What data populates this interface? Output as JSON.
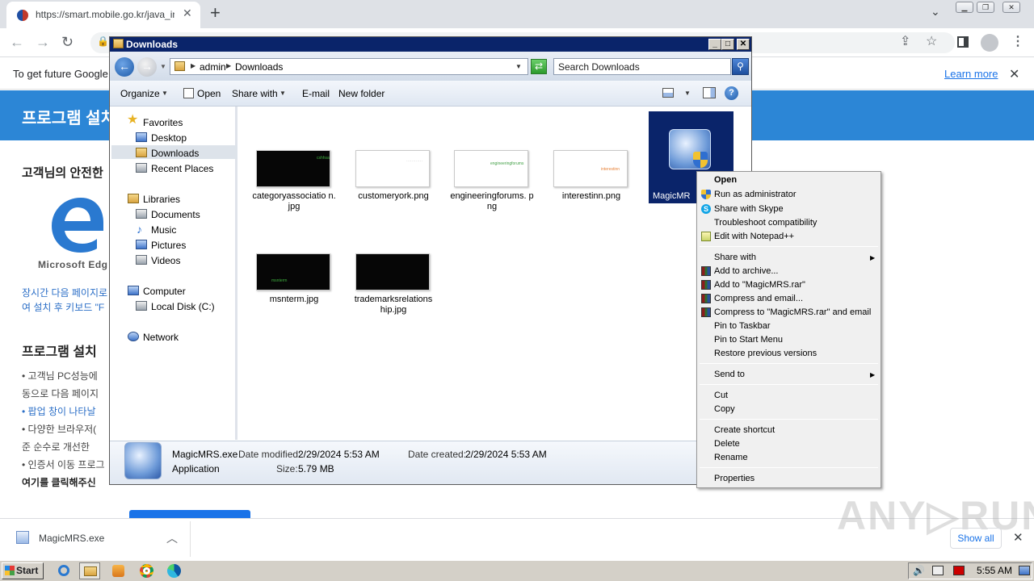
{
  "browser": {
    "tab_title": "https://smart.mobile.go.kr/java_inst",
    "tab_close": "✕",
    "new_tab": "+",
    "infobar_text": "To get future Google",
    "learn_more": "Learn more"
  },
  "page": {
    "banner_title": "프로그램 설치",
    "safety_heading": "고객님의 안전한",
    "edge_label": "Microsoft Edg",
    "blue_text_1": "장시간 다음 페이지로",
    "blue_text_2": "여 설치 후 키보드 \"F",
    "install_heading": "프로그램 설치 ",
    "bullets": [
      "• 고객님 PC성능에",
      "  동으로 다음 페이지",
      "• 팝업 창이 나타날",
      "• 다양한 브라우저(",
      "  준 순수로 개선한",
      "• 인증서 이동 프로그",
      "  여기를 클릭해주신"
    ]
  },
  "download_shelf": {
    "file_name": "MagicMRS.exe",
    "show_all": "Show all"
  },
  "watermark": "ANY▷RUN",
  "taskbar": {
    "start": "Start",
    "clock": "5:55 AM"
  },
  "explorer": {
    "title": "Downloads",
    "breadcrumb": [
      "admin",
      "Downloads"
    ],
    "search_placeholder": "Search Downloads",
    "commands": {
      "organize": "Organize",
      "open": "Open",
      "share_with": "Share with",
      "email": "E-mail",
      "new_folder": "New folder"
    },
    "nav": {
      "favorites": "Favorites",
      "desktop": "Desktop",
      "downloads": "Downloads",
      "recent_places": "Recent Places",
      "libraries": "Libraries",
      "documents": "Documents",
      "music": "Music",
      "pictures": "Pictures",
      "videos": "Videos",
      "computer": "Computer",
      "local_disk": "Local Disk (C:)",
      "network": "Network"
    },
    "files": [
      {
        "name": "categoryassociatio n.jpg",
        "thumb": "dark",
        "mark": "cshhsa"
      },
      {
        "name": "customeryork.png",
        "thumb": "light",
        "mark": "············"
      },
      {
        "name": "engineeringforums. png",
        "thumb": "light",
        "mark": "engineeringforums"
      },
      {
        "name": "interestinn.png",
        "thumb": "light",
        "mark": "interestinn"
      },
      {
        "name": "msnterm.jpg",
        "thumb": "dark",
        "mark": "msnterm"
      },
      {
        "name": "trademarksrelations hip.jpg",
        "thumb": "dark",
        "mark": ""
      }
    ],
    "selected_file": "MagicMR",
    "details": {
      "name": "MagicMRS.exe",
      "type": "Application",
      "modified_label": "Date modified:",
      "modified_value": "2/29/2024 5:53 AM",
      "created_label": "Date created:",
      "created_value": "2/29/2024 5:53 AM",
      "size_label": "Size:",
      "size_value": "5.79 MB"
    }
  },
  "context_menu": {
    "open": "Open",
    "run_as_admin": "Run as administrator",
    "share_skype": "Share with Skype",
    "troubleshoot": "Troubleshoot compatibility",
    "edit_npp": "Edit with Notepad++",
    "share_with": "Share with",
    "add_archive": "Add to archive...",
    "add_rar": "Add to \"MagicMRS.rar\"",
    "compress_email": "Compress and email...",
    "compress_rar_email": "Compress to \"MagicMRS.rar\" and email",
    "pin_taskbar": "Pin to Taskbar",
    "pin_start": "Pin to Start Menu",
    "restore_versions": "Restore previous versions",
    "send_to": "Send to",
    "cut": "Cut",
    "copy": "Copy",
    "create_shortcut": "Create shortcut",
    "delete": "Delete",
    "rename": "Rename",
    "properties": "Properties"
  }
}
